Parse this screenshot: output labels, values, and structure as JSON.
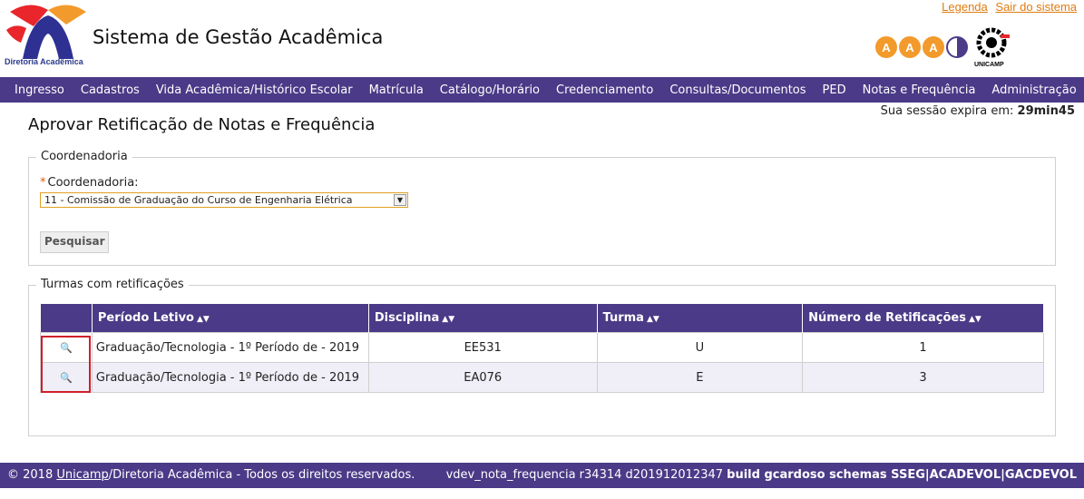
{
  "header": {
    "app_title": "Sistema de Gestão Acadêmica",
    "logo_text": "Diretoria Acadêmica",
    "links": [
      "Legenda",
      "Sair do sistema"
    ],
    "access_letters": [
      "A",
      "A",
      "A"
    ],
    "unicamp_label": "UNICAMP"
  },
  "menu": [
    "Ingresso",
    "Cadastros",
    "Vida Acadêmica/Histórico Escolar",
    "Matrícula",
    "Catálogo/Horário",
    "Credenciamento",
    "Consultas/Documentos",
    "PED",
    "Notas e Frequência",
    "Administração"
  ],
  "session": {
    "label": "Sua sessão expira em:",
    "value": "29min45"
  },
  "page_title": "Aprovar Retificação de Notas e Frequência",
  "coordenadoria": {
    "legend": "Coordenadoria",
    "label": "Coordenadoria:",
    "selected": "11 - Comissão de Graduação do Curso de Engenharia Elétrica",
    "button": "Pesquisar"
  },
  "turmas": {
    "legend": "Turmas com retificações",
    "columns": [
      "Período Letivo",
      "Disciplina",
      "Turma",
      "Número de Retificações"
    ],
    "rows": [
      {
        "periodo": "Graduação/Tecnologia - 1º Período de - 2019",
        "disciplina": "EE531",
        "turma": "U",
        "numero": "1"
      },
      {
        "periodo": "Graduação/Tecnologia - 1º Período de - 2019",
        "disciplina": "EA076",
        "turma": "E",
        "numero": "3"
      }
    ]
  },
  "footer": {
    "copyright_prefix": "© 2018 ",
    "copyright_link": "Unicamp",
    "copyright_suffix": "/Diretoria Acadêmica - Todos os direitos reservados.",
    "version": "vdev_nota_frequencia r34314 d201912012347",
    "build": "build gcardoso schemas SSEG|ACADEVOL|GACDEVOL"
  },
  "colors": {
    "primary": "#4a3a87",
    "accent": "#f39a2c",
    "link": "#e07c10",
    "highlight": "#d0202a"
  }
}
